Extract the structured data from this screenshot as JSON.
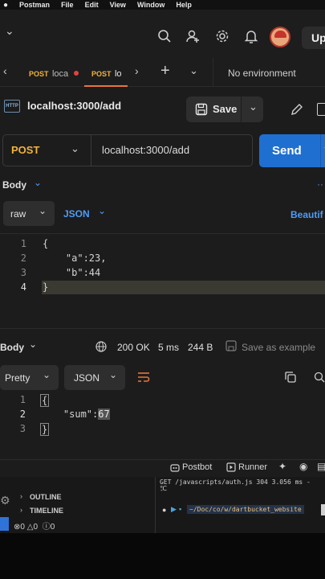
{
  "menubar": {
    "app": "Postman",
    "items": [
      "File",
      "Edit",
      "View",
      "Window",
      "Help"
    ]
  },
  "header": {
    "upgrade_label": "Up"
  },
  "tabs": [
    {
      "method": "POST",
      "label": "loca",
      "unsaved": true
    },
    {
      "method": "POST",
      "label": "lo",
      "active": true
    }
  ],
  "environment": "No environment",
  "request": {
    "name": "localhost:3000/add",
    "save_label": "Save",
    "method": "POST",
    "url": "localhost:3000/add",
    "send_label": "Send"
  },
  "request_body": {
    "section_label": "Body",
    "mode": "raw",
    "language": "JSON",
    "beautify_label": "Beautif",
    "lines": [
      {
        "n": "1",
        "text": "{"
      },
      {
        "n": "2",
        "text": "    \"a\":23,"
      },
      {
        "n": "3",
        "text": "    \"b\":44"
      },
      {
        "n": "4",
        "text": "}"
      }
    ]
  },
  "response": {
    "section_label": "Body",
    "status": "200 OK",
    "time": "5 ms",
    "size": "244 B",
    "save_example_label": "Save as example",
    "view_mode": "Pretty",
    "language": "JSON",
    "lines": [
      {
        "n": "1",
        "text": "{"
      },
      {
        "n": "2",
        "text": "    \"sum\":",
        "value": "67"
      },
      {
        "n": "3",
        "text": "}"
      }
    ]
  },
  "statusbar": {
    "postbot": "Postbot",
    "runner": "Runner"
  },
  "vscode": {
    "outline": "OUTLINE",
    "timeline": "TIMELINE",
    "errors": "0",
    "warnings": "0",
    "infos": "0",
    "terminal_line1": "GET /javascripts/auth.js 304 3.056 ms -",
    "terminal_line1b": "-",
    "terminal_path": "~/Doc/co/w/dartbucket_website"
  },
  "colors": {
    "accent": "#1f6fd1",
    "method": "#f2b33d",
    "link": "#4f9cf5",
    "unsaved": "#e0443e"
  }
}
